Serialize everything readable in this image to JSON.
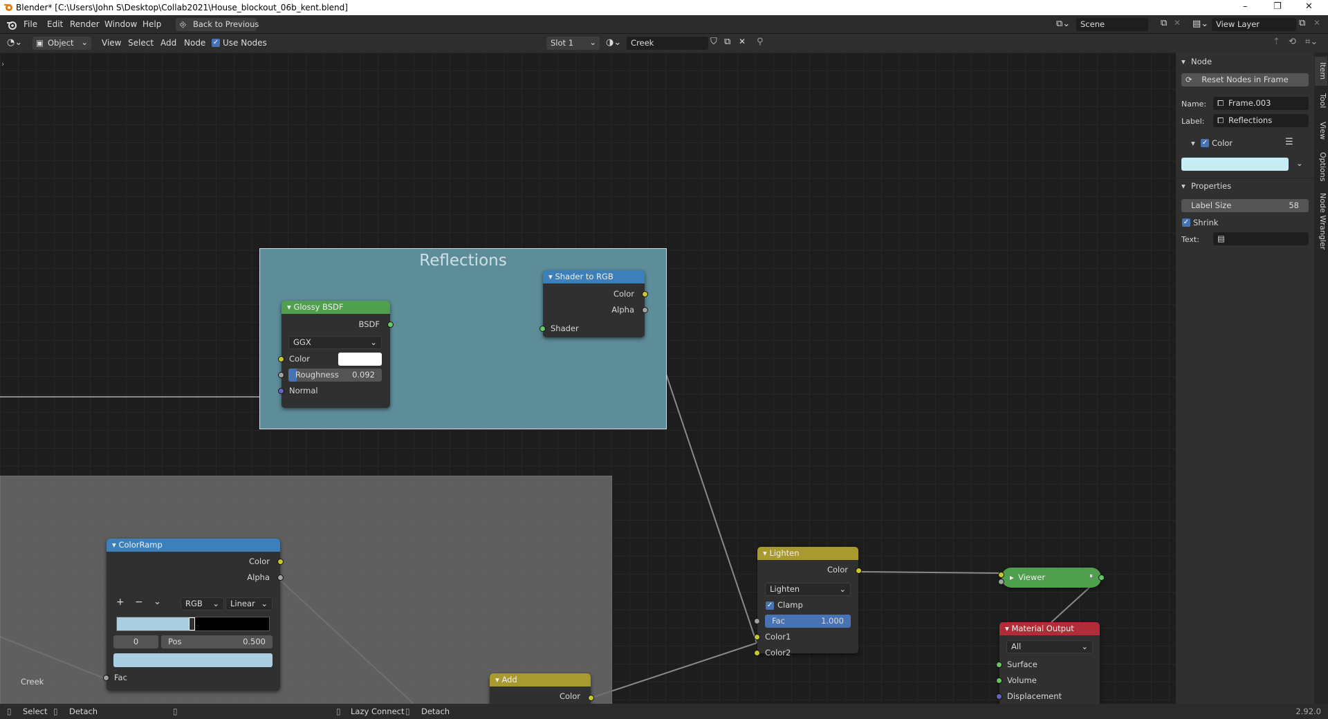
{
  "window": {
    "title": "Blender* [C:\\Users\\John S\\Desktop\\Collab2021\\House_blockout_06b_kent.blend]",
    "controls": {
      "minimize": "–",
      "maximize": "❐",
      "close": "✕"
    }
  },
  "menubar": {
    "items": [
      "File",
      "Edit",
      "Render",
      "Window",
      "Help"
    ],
    "back_button": "Back to Previous",
    "scene": "Scene",
    "view_layer": "View Layer"
  },
  "header": {
    "mode": "Object",
    "menus": [
      "View",
      "Select",
      "Add",
      "Node"
    ],
    "use_nodes": "Use Nodes",
    "slot": "Slot 1",
    "material": "Creek"
  },
  "frames": {
    "reflections_label": "Reflections"
  },
  "nodes": {
    "glossy": {
      "title": "Glossy BSDF",
      "output": "BSDF",
      "distribution": "GGX",
      "color_label": "Color",
      "roughness_label": "Roughness",
      "roughness_value": "0.092",
      "roughness_fraction": 0.092,
      "normal_label": "Normal"
    },
    "shader_to_rgb": {
      "title": "Shader to RGB",
      "out_color": "Color",
      "out_alpha": "Alpha",
      "in_shader": "Shader"
    },
    "colorramp": {
      "title": "ColorRamp",
      "out_color": "Color",
      "out_alpha": "Alpha",
      "add": "+",
      "remove": "−",
      "menu": "⌄",
      "color_mode": "RGB",
      "interpolation": "Linear",
      "stop_index": "0",
      "pos_label": "Pos",
      "pos_value": "0.500",
      "in_fac": "Fac"
    },
    "creek_label": "Creek",
    "add": {
      "title": "Add",
      "out_color": "Color"
    },
    "lighten": {
      "title": "Lighten",
      "out_color": "Color",
      "blend_type": "Lighten",
      "clamp": "Clamp",
      "fac_label": "Fac",
      "fac_value": "1.000",
      "color1": "Color1",
      "color2": "Color2"
    },
    "viewer": {
      "title": "Viewer"
    },
    "material_output": {
      "title": "Material Output",
      "target": "All",
      "surface": "Surface",
      "volume": "Volume",
      "displacement": "Displacement"
    }
  },
  "sidebar": {
    "node_panel": "Node",
    "reset_button": "Reset Nodes in Frame",
    "name_label": "Name:",
    "name_value": "Frame.003",
    "label_label": "Label:",
    "label_value": "Reflections",
    "color_panel": "Color",
    "properties_panel": "Properties",
    "label_size_label": "Label Size",
    "label_size_value": "58",
    "shrink": "Shrink",
    "text_label": "Text:",
    "tabs": [
      "Item",
      "Tool",
      "View",
      "Options",
      "Node Wrangler"
    ]
  },
  "statusbar": {
    "select": "Select",
    "detach": "Detach",
    "lazy_connect": "Lazy Connect",
    "detach2": "Detach",
    "version": "2.92.0"
  },
  "colors": {
    "frame_reflections": "#5e8d9a",
    "frame_grey": "#6b6b6b",
    "sidebar_color_swatch": "#c8ecf4",
    "shader_header": "#5a9fd6",
    "glossy_header": "#4f9f4f",
    "converter_header": "#3d7fb8",
    "color_header": "#a89a2e",
    "output_header": "#b02c36"
  }
}
